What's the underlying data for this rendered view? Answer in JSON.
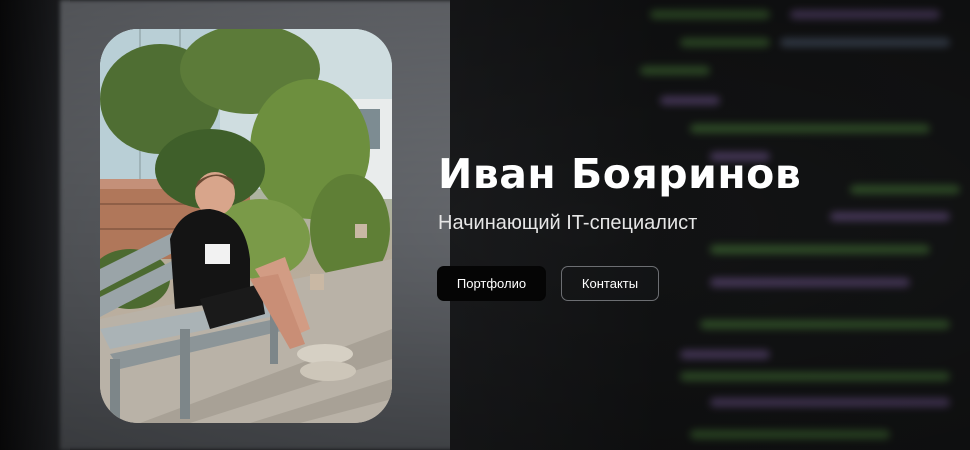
{
  "hero": {
    "name": "Иван Бояринов",
    "subtitle": "Начинающий IT-специалист",
    "buttons": {
      "portfolio_label": "Портфолио",
      "contacts_label": "Контакты"
    },
    "photo": {
      "alt": "Иван Бояринов"
    }
  },
  "colors": {
    "name_text": "#ffffff",
    "subtitle_text": "#e6e6e6",
    "primary_button_bg": "#050505",
    "secondary_button_border": "#6c6e72",
    "code_green": "#4f8a3e",
    "code_purple": "#7d5fa0"
  }
}
